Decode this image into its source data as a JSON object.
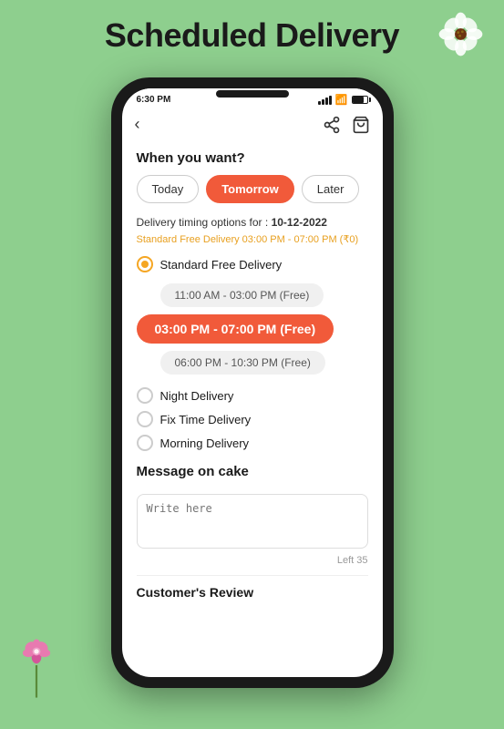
{
  "page": {
    "title": "Scheduled Delivery",
    "background_color": "#8ecf8e"
  },
  "status_bar": {
    "time": "6:30 PM",
    "battery_label": "battery"
  },
  "nav": {
    "back_icon": "‹",
    "share_icon": "share",
    "bag_icon": "bag"
  },
  "delivery": {
    "question": "When you want?",
    "options": [
      {
        "label": "Today",
        "active": false
      },
      {
        "label": "Tomorrow",
        "active": true
      },
      {
        "label": "Later",
        "active": false
      }
    ],
    "timing_prefix": "Delivery timing options for :",
    "timing_date": "10-12-2022",
    "free_timing": "Standard Free Delivery   03:00 PM - 07:00 PM (₹0)",
    "delivery_types": [
      {
        "label": "Standard Free Delivery",
        "selected": true,
        "slots": [
          {
            "label": "11:00 AM - 03:00 PM (Free)",
            "selected": false
          },
          {
            "label": "03:00 PM - 07:00 PM (Free)",
            "selected": true
          },
          {
            "label": "06:00 PM - 10:30 PM (Free)",
            "selected": false
          }
        ]
      },
      {
        "label": "Night Delivery",
        "selected": false
      },
      {
        "label": "Fix Time Delivery",
        "selected": false
      },
      {
        "label": "Morning Delivery",
        "selected": false
      }
    ]
  },
  "message": {
    "section_title": "Message on cake",
    "placeholder": "Write here",
    "char_count_label": "Left 35"
  },
  "customer_review": {
    "title": "Customer's Review"
  }
}
